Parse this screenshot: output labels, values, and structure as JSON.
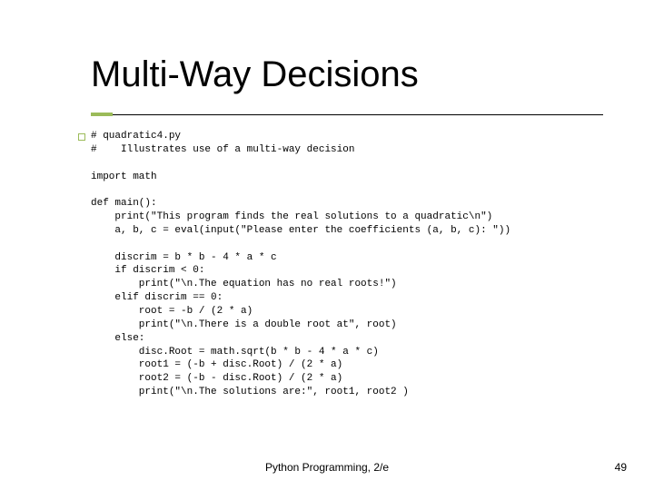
{
  "title": "Multi-Way Decisions",
  "code": "# quadratic4.py\n#    Illustrates use of a multi-way decision\n\nimport math\n\ndef main():\n    print(\"This program finds the real solutions to a quadratic\\n\")\n    a, b, c = eval(input(\"Please enter the coefficients (a, b, c): \"))\n\n    discrim = b * b - 4 * a * c\n    if discrim < 0:\n        print(\"\\n.The equation has no real roots!\")\n    elif discrim == 0:\n        root = -b / (2 * a)\n        print(\"\\n.There is a double root at\", root)\n    else:\n        disc.Root = math.sqrt(b * b - 4 * a * c)\n        root1 = (-b + disc.Root) / (2 * a)\n        root2 = (-b - disc.Root) / (2 * a)\n        print(\"\\n.The solutions are:\", root1, root2 )",
  "footer": {
    "center": "Python Programming, 2/e",
    "page": "49"
  },
  "colors": {
    "accent": "#9bbb59"
  }
}
